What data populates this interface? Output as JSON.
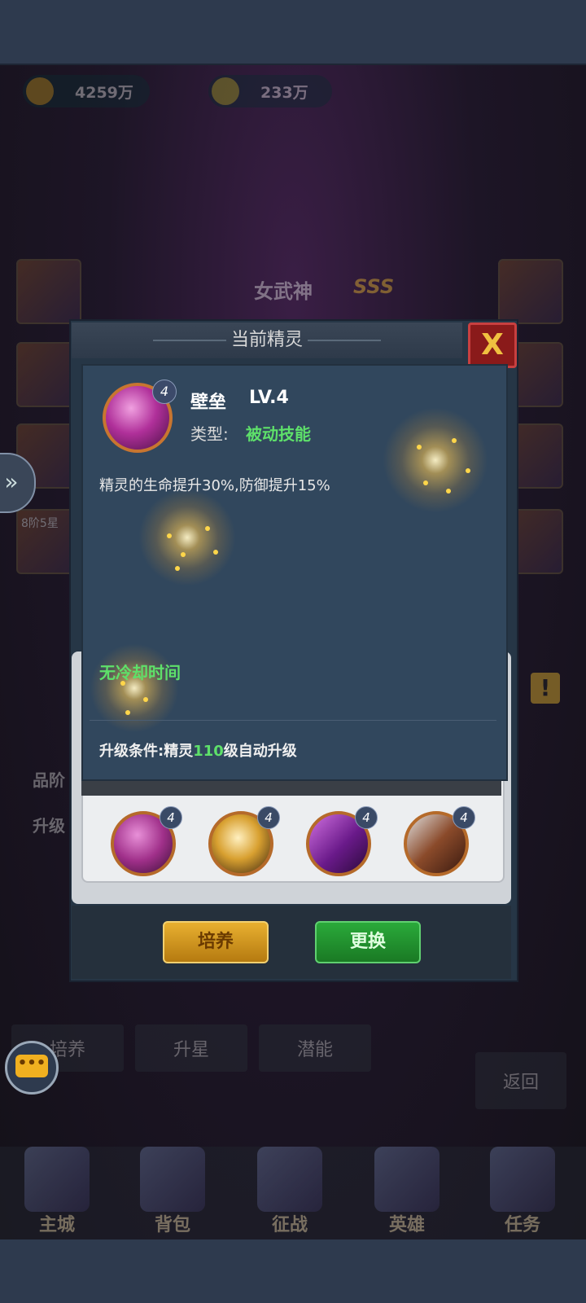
{
  "resources": {
    "gold": "4259万",
    "gems": "233万"
  },
  "hero": {
    "name": "女武神",
    "rank": "SSS",
    "side_note": "8阶5星"
  },
  "popup": {
    "title": "当前精灵",
    "close_label": "X",
    "sprite": {
      "icon": "purple-orb-icon",
      "level_badge": "4",
      "name": "壁垒",
      "level": "LV.4",
      "type_label": "类型:",
      "type_value": "被动技能",
      "description": "精灵的生命提升30%,防御提升15%",
      "cooldown": "无冷却时间",
      "upgrade_prefix": "升级条件:精灵",
      "upgrade_level": "110",
      "upgrade_suffix": "级自动升级"
    },
    "lower_labels": {
      "quality": "品阶",
      "upgrade": "升级"
    },
    "slots": [
      {
        "icon": "purple-orb-icon",
        "badge": "4"
      },
      {
        "icon": "golden-burst-icon",
        "badge": "4"
      },
      {
        "icon": "purple-slash-icon",
        "badge": "4"
      },
      {
        "icon": "axe-icon",
        "badge": "4"
      }
    ],
    "train_button": "培养",
    "swap_button": "更换"
  },
  "bottom_tabs": [
    "培养",
    "升星",
    "潜能"
  ],
  "back_button": "返回",
  "nav": [
    "主城",
    "背包",
    "征战",
    "英雄",
    "任务"
  ],
  "colors": {
    "accent_green": "#5ee06a",
    "panel_bg": "#31475d",
    "close_red": "#8a1a1a"
  }
}
